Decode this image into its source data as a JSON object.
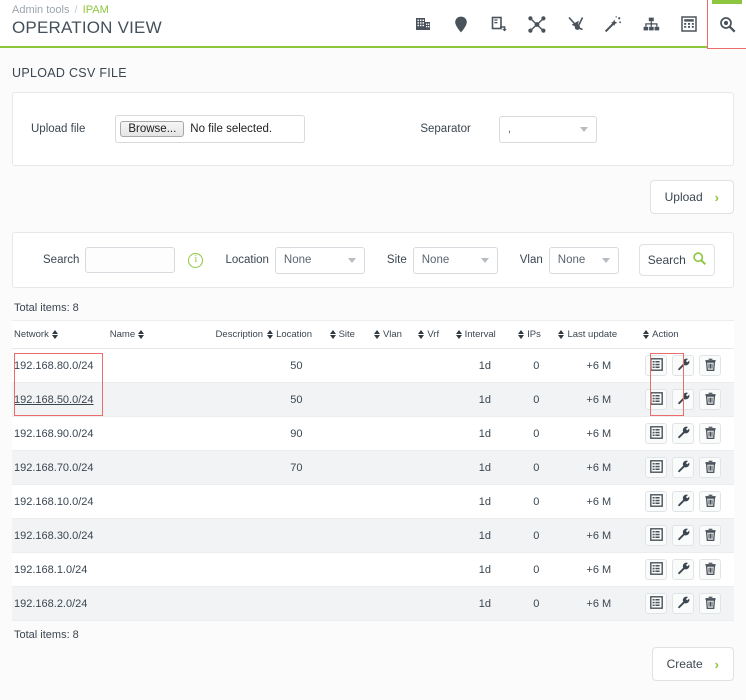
{
  "header": {
    "breadcrumb_root": "Admin tools",
    "breadcrumb_sep": "/",
    "breadcrumb_current": "IPAM",
    "title": "OPERATION VIEW",
    "accent_color": "#8cc63f",
    "highlight_color": "#ec6b6b",
    "toolbar": [
      {
        "name": "building-icon",
        "label": "Buildings",
        "active": false
      },
      {
        "name": "map-pin-icon",
        "label": "Locations",
        "active": false
      },
      {
        "name": "device-exit-icon",
        "label": "Devices",
        "active": false
      },
      {
        "name": "network-nodes-icon",
        "label": "Network map",
        "active": false
      },
      {
        "name": "aggregate-arrow-icon",
        "label": "Aggregate",
        "active": false
      },
      {
        "name": "magic-wand-icon",
        "label": "Wizard",
        "active": false
      },
      {
        "name": "sitemap-icon",
        "label": "Hierarchy",
        "active": false
      },
      {
        "name": "calculator-icon",
        "label": "Calculator",
        "active": false
      },
      {
        "name": "search-magnifier-icon",
        "label": "Operation view",
        "active": true
      }
    ]
  },
  "upload_section": {
    "title": "UPLOAD CSV FILE",
    "upload_file_label": "Upload file",
    "browse_button": "Browse...",
    "file_status": "No file selected.",
    "separator_label": "Separator",
    "separator_value": ",",
    "upload_button": "Upload",
    "chevron": "›"
  },
  "search_section": {
    "search_label": "Search",
    "search_value": "",
    "search_placeholder": "",
    "info_icon_char": "i",
    "location_label": "Location",
    "location_value": "None",
    "site_label": "Site",
    "site_value": "None",
    "vlan_label": "Vlan",
    "vlan_value": "None",
    "search_button": "Search"
  },
  "table": {
    "total_items_top": "Total items: 8",
    "total_items_bottom": "Total items: 8",
    "columns": [
      {
        "label": "Network",
        "sortable": true,
        "align": "left"
      },
      {
        "label": "Name",
        "sortable": true,
        "align": "left"
      },
      {
        "label": "Description",
        "sortable": true,
        "align": "right"
      },
      {
        "label": "Location",
        "sortable": true,
        "align": "left"
      },
      {
        "label": "Site",
        "sortable": true,
        "align": "left"
      },
      {
        "label": "Vlan",
        "sortable": true,
        "align": "left"
      },
      {
        "label": "Vrf",
        "sortable": true,
        "align": "left"
      },
      {
        "label": "Interval",
        "sortable": true,
        "align": "left"
      },
      {
        "label": "IPs",
        "sortable": true,
        "align": "left"
      },
      {
        "label": "Last update",
        "sortable": true,
        "align": "left"
      },
      {
        "label": "Action",
        "sortable": false,
        "align": "left"
      }
    ],
    "rows": [
      {
        "network": "192.168.80.0/24",
        "linked": false,
        "name": "",
        "description": "",
        "location": "50",
        "site": "",
        "vlan": "",
        "vrf": "",
        "interval": "1d",
        "ips": "0",
        "last_update": "+6 M"
      },
      {
        "network": "192.168.50.0/24",
        "linked": true,
        "name": "",
        "description": "",
        "location": "50",
        "site": "",
        "vlan": "",
        "vrf": "",
        "interval": "1d",
        "ips": "0",
        "last_update": "+6 M"
      },
      {
        "network": "192.168.90.0/24",
        "linked": false,
        "name": "",
        "description": "",
        "location": "90",
        "site": "",
        "vlan": "",
        "vrf": "",
        "interval": "1d",
        "ips": "0",
        "last_update": "+6 M"
      },
      {
        "network": "192.168.70.0/24",
        "linked": false,
        "name": "",
        "description": "",
        "location": "70",
        "site": "",
        "vlan": "",
        "vrf": "",
        "interval": "1d",
        "ips": "0",
        "last_update": "+6 M"
      },
      {
        "network": "192.168.10.0/24",
        "linked": false,
        "name": "",
        "description": "",
        "location": "",
        "site": "",
        "vlan": "",
        "vrf": "",
        "interval": "1d",
        "ips": "0",
        "last_update": "+6 M"
      },
      {
        "network": "192.168.30.0/24",
        "linked": false,
        "name": "",
        "description": "",
        "location": "",
        "site": "",
        "vlan": "",
        "vrf": "",
        "interval": "1d",
        "ips": "0",
        "last_update": "+6 M"
      },
      {
        "network": "192.168.1.0/24",
        "linked": false,
        "name": "",
        "description": "",
        "location": "",
        "site": "",
        "vlan": "",
        "vrf": "",
        "interval": "1d",
        "ips": "0",
        "last_update": "+6 M"
      },
      {
        "network": "192.168.2.0/24",
        "linked": false,
        "name": "",
        "description": "",
        "location": "",
        "site": "",
        "vlan": "",
        "vrf": "",
        "interval": "1d",
        "ips": "0",
        "last_update": "+6 M"
      }
    ],
    "row_actions": [
      {
        "name": "view-details-icon",
        "label": "Details"
      },
      {
        "name": "wrench-settings-icon",
        "label": "Manage"
      },
      {
        "name": "trash-delete-icon",
        "label": "Delete"
      }
    ]
  },
  "footer": {
    "create_button": "Create",
    "chevron": "›"
  }
}
